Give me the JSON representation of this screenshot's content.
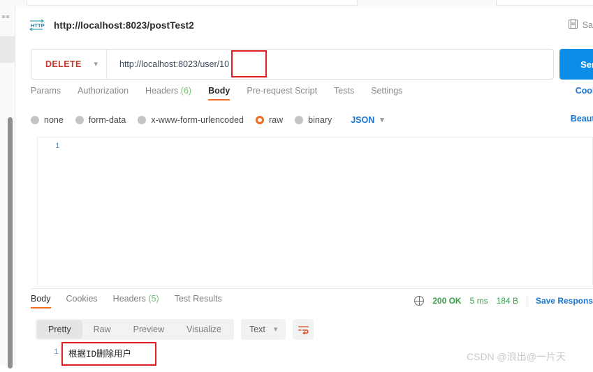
{
  "request": {
    "title": "http://localhost:8023/postTest2",
    "protocol_icon": "http-badge-icon",
    "save_label": "Sa",
    "save_icon": "floppy-disk-icon",
    "method": "DELETE",
    "method_chevron": "chevron-down-icon",
    "url": "http://localhost:8023/user/10",
    "send_label": "Send",
    "tabs": [
      {
        "label": "Params",
        "count": "",
        "active": false
      },
      {
        "label": "Authorization",
        "count": "",
        "active": false
      },
      {
        "label": "Headers",
        "count": "(6)",
        "active": false
      },
      {
        "label": "Body",
        "count": "",
        "active": true
      },
      {
        "label": "Pre-request Script",
        "count": "",
        "active": false
      },
      {
        "label": "Tests",
        "count": "",
        "active": false
      },
      {
        "label": "Settings",
        "count": "",
        "active": false
      }
    ],
    "cookies_link": "Cook",
    "body_types": [
      {
        "label": "none",
        "selected": false
      },
      {
        "label": "form-data",
        "selected": false
      },
      {
        "label": "x-www-form-urlencoded",
        "selected": false
      },
      {
        "label": "raw",
        "selected": true
      },
      {
        "label": "binary",
        "selected": false
      }
    ],
    "format_select": "JSON",
    "format_chevron": "chevron-down-icon",
    "beautify_label": "Beauti",
    "editor_line_number": "1",
    "editor_content": ""
  },
  "response": {
    "tabs": [
      {
        "label": "Body",
        "count": "",
        "active": true
      },
      {
        "label": "Cookies",
        "count": "",
        "active": false
      },
      {
        "label": "Headers",
        "count": "(5)",
        "active": false
      },
      {
        "label": "Test Results",
        "count": "",
        "active": false
      }
    ],
    "globe_icon": "globe-icon",
    "status": "200 OK",
    "time": "5 ms",
    "size": "184 B",
    "save_response_label": "Save Respons",
    "view_modes": [
      {
        "label": "Pretty",
        "active": true
      },
      {
        "label": "Raw",
        "active": false
      },
      {
        "label": "Preview",
        "active": false
      },
      {
        "label": "Visualize",
        "active": false
      }
    ],
    "format_select": "Text",
    "format_chevron": "chevron-down-icon",
    "wrap_icon": "word-wrap-icon",
    "copy_icon": "copy-icon",
    "line_number": "1",
    "body_text": "根据ID删除用户"
  },
  "annotations": {
    "highlight_color": "#e02020",
    "url_highlight_target": "/10",
    "response_highlight_target": "根据ID删除用户"
  },
  "watermark": "CSDN @浪出@一片天",
  "colors": {
    "accent_orange": "#f26b21",
    "link_blue": "#1874d2",
    "send_blue": "#0d8ce8",
    "method_red": "#c0392b",
    "status_green": "#3a9e4b"
  }
}
